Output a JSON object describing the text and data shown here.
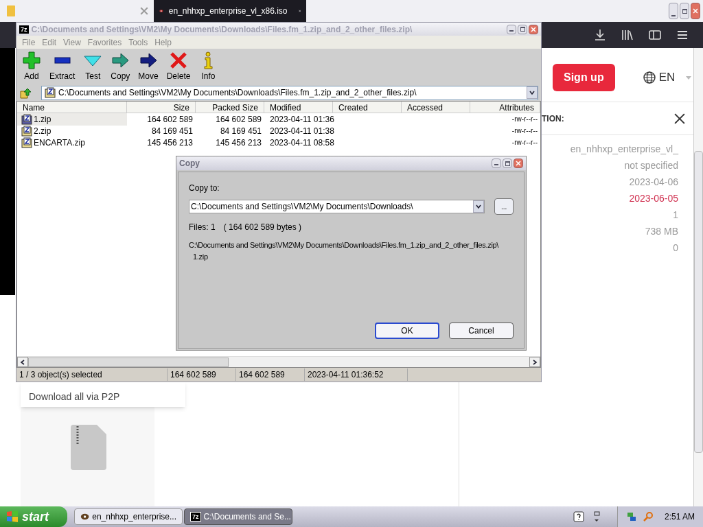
{
  "browser": {
    "tabs": [
      {
        "selected": false
      },
      {
        "title": "en_nhhxp_enterprise_vl_x86.iso",
        "selected": true
      }
    ],
    "signup": "Sign up",
    "language": "EN",
    "info": {
      "heading": "TION:",
      "values": [
        {
          "text": "en_nhhxp_enterprise_vl_",
          "highlighted": false
        },
        {
          "text": "not specified",
          "highlighted": false
        },
        {
          "text": "2023-04-06",
          "highlighted": false
        },
        {
          "text": "2023-06-05",
          "highlighted": true
        },
        {
          "text": "1",
          "highlighted": false
        },
        {
          "text": "738 MB",
          "highlighted": false
        },
        {
          "text": "0",
          "highlighted": false
        }
      ]
    },
    "download": "Download all via P2P"
  },
  "archiver": {
    "logo": "7z",
    "title": "C:\\Documents and Settings\\VM2\\My Documents\\Downloads\\Files.fm_1.zip_and_2_other_files.zip\\",
    "menu": [
      "File",
      "Edit",
      "View",
      "Favorites",
      "Tools",
      "Help"
    ],
    "toolbar": [
      {
        "kind": "add",
        "label": "Add"
      },
      {
        "kind": "extract",
        "label": "Extract"
      },
      {
        "kind": "test",
        "label": "Test"
      },
      {
        "kind": "copy",
        "label": "Copy"
      },
      {
        "kind": "move",
        "label": "Move"
      },
      {
        "kind": "delete",
        "label": "Delete"
      },
      {
        "kind": "info",
        "label": "Info"
      }
    ],
    "address": "C:\\Documents and Settings\\VM2\\My Documents\\Downloads\\Files.fm_1.zip_and_2_other_files.zip\\",
    "columns": [
      "Name",
      "Size",
      "Packed Size",
      "Modified",
      "Created",
      "Accessed",
      "Attributes"
    ],
    "rows": [
      {
        "name": "1.zip",
        "size": "164 602 589",
        "packed": "164 602 589",
        "modified": "2023-04-11 01:36",
        "attributes": "-rw-r--r--",
        "selected": true
      },
      {
        "name": "2.zip",
        "size": "84 169 451",
        "packed": "84 169 451",
        "modified": "2023-04-11 01:38",
        "attributes": "-rw-r--r--",
        "selected": false
      },
      {
        "name": "ENCARTA.zip",
        "size": "145 456 213",
        "packed": "145 456 213",
        "modified": "2023-04-11 08:58",
        "attributes": "-rw-r--r--",
        "selected": false
      }
    ],
    "status": [
      "1 / 3 object(s) selected",
      "164 602 589",
      "164 602 589",
      "2023-04-11 01:36:52"
    ]
  },
  "dialog": {
    "title": "Copy",
    "label": "Copy to:",
    "value": "C:\\Documents and Settings\\VM2\\My Documents\\Downloads\\",
    "browse": "...",
    "files": "Files: 1",
    "bytes": "( 164 602 589 bytes )",
    "source": [
      "C:\\Documents and Settings\\VM2\\My Documents\\Downloads\\Files.fm_1.zip_and_2_other_files.zip\\",
      "1.zip"
    ],
    "ok": "OK",
    "cancel": "Cancel"
  },
  "taskbar": {
    "start": "start",
    "items": [
      {
        "kind": "browser",
        "label": "en_nhhxp_enterprise...",
        "selected": false
      },
      {
        "kind": "archiver",
        "logo": "7z",
        "label": "C:\\Documents and Se...",
        "selected": true
      }
    ],
    "clock": "2:51 AM"
  }
}
